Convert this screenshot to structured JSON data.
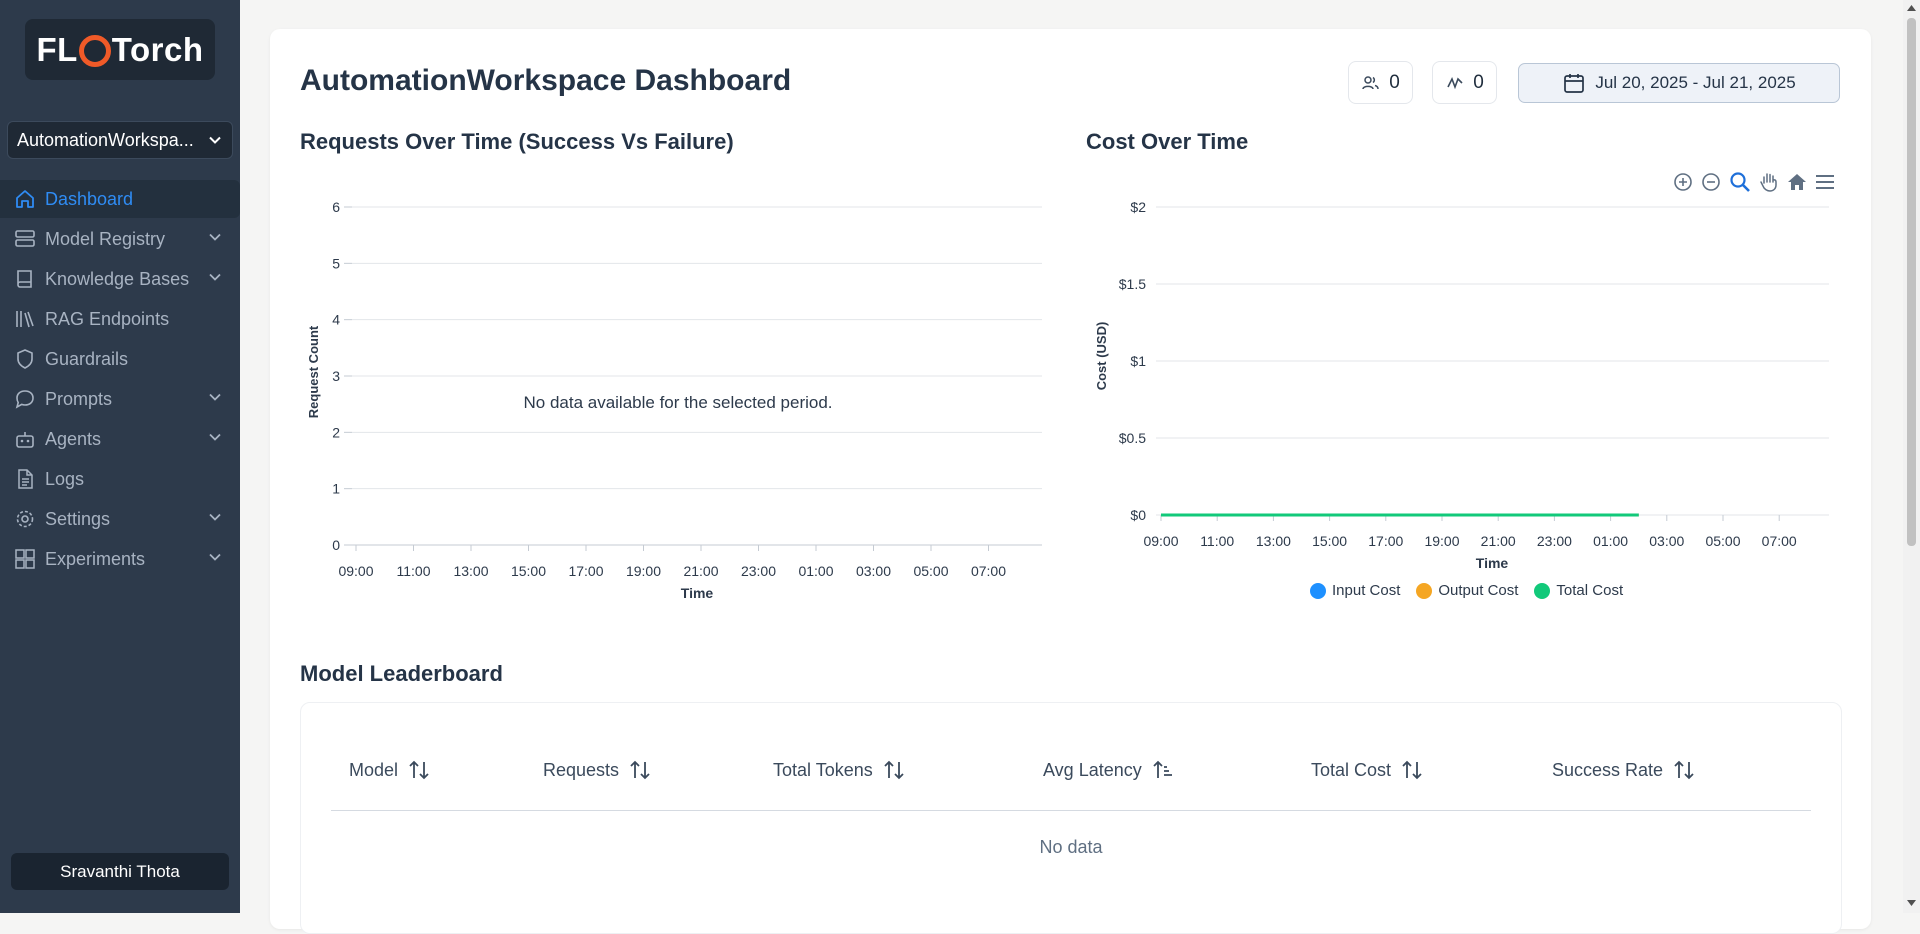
{
  "sidebar": {
    "logo": "FLOTorch",
    "workspace_select": "AutomationWorkspa...",
    "items": [
      {
        "label": "Dashboard",
        "active": true,
        "expandable": false
      },
      {
        "label": "Model Registry",
        "active": false,
        "expandable": true
      },
      {
        "label": "Knowledge Bases",
        "active": false,
        "expandable": true
      },
      {
        "label": "RAG Endpoints",
        "active": false,
        "expandable": false
      },
      {
        "label": "Guardrails",
        "active": false,
        "expandable": false
      },
      {
        "label": "Prompts",
        "active": false,
        "expandable": true
      },
      {
        "label": "Agents",
        "active": false,
        "expandable": true
      },
      {
        "label": "Logs",
        "active": false,
        "expandable": false
      },
      {
        "label": "Settings",
        "active": false,
        "expandable": true
      },
      {
        "label": "Experiments",
        "active": false,
        "expandable": true
      }
    ],
    "user_name": "Sravanthi Thota"
  },
  "header": {
    "title": "AutomationWorkspace Dashboard",
    "users_count": "0",
    "models_count": "0",
    "date_range": "Jul 20, 2025 - Jul 21, 2025"
  },
  "requests_chart": {
    "heading": "Requests Over Time (Success Vs Failure)",
    "empty_message": "No data available for the selected period."
  },
  "cost_chart": {
    "heading": "Cost Over Time"
  },
  "chart_data": [
    {
      "type": "line",
      "title": "Requests Over Time (Success Vs Failure)",
      "xlabel": "Time",
      "ylabel": "Request Count",
      "x_ticks": [
        "09:00",
        "11:00",
        "13:00",
        "15:00",
        "17:00",
        "19:00",
        "21:00",
        "23:00",
        "01:00",
        "03:00",
        "05:00",
        "07:00"
      ],
      "y_ticks": [
        "0",
        "1",
        "2",
        "3",
        "4",
        "5",
        "6"
      ],
      "ylim": [
        0,
        6
      ],
      "series": [],
      "grid": true
    },
    {
      "type": "line",
      "title": "Cost Over Time",
      "xlabel": "Time",
      "ylabel": "Cost (USD)",
      "x_ticks": [
        "09:00",
        "11:00",
        "13:00",
        "15:00",
        "17:00",
        "19:00",
        "21:00",
        "23:00",
        "01:00",
        "03:00",
        "05:00",
        "07:00"
      ],
      "y_ticks": [
        "$0",
        "$0.5",
        "$1",
        "$1.5",
        "$2"
      ],
      "ylim": [
        0,
        2
      ],
      "grid": true,
      "legend_position": "bottom",
      "series": [
        {
          "name": "Input Cost",
          "color": "#1e90ff",
          "x": [
            "09:00",
            "02:00"
          ],
          "values": [
            0,
            0
          ]
        },
        {
          "name": "Output Cost",
          "color": "#f5a623",
          "x": [
            "09:00",
            "02:00"
          ],
          "values": [
            0,
            0
          ]
        },
        {
          "name": "Total Cost",
          "color": "#12c97a",
          "x": [
            "09:00",
            "02:00"
          ],
          "values": [
            0,
            0
          ]
        }
      ]
    }
  ],
  "leaderboard": {
    "heading": "Model Leaderboard",
    "columns": [
      "Model",
      "Requests",
      "Total Tokens",
      "Avg Latency",
      "Total Cost",
      "Success Rate"
    ],
    "empty_message": "No data"
  }
}
